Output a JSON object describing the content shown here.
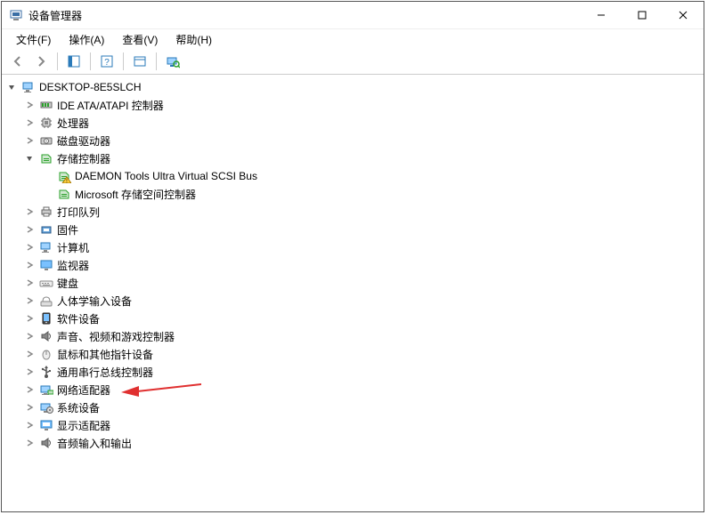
{
  "window": {
    "title": "设备管理器"
  },
  "menus": {
    "file": "文件(F)",
    "action": "操作(A)",
    "view": "查看(V)",
    "help": "帮助(H)"
  },
  "tree": {
    "root": {
      "label": "DESKTOP-8E5SLCH",
      "expanded": true,
      "children": [
        {
          "id": "ide",
          "label": "IDE ATA/ATAPI 控制器",
          "icon": "ide",
          "expanded": false
        },
        {
          "id": "cpu",
          "label": "处理器",
          "icon": "cpu",
          "expanded": false
        },
        {
          "id": "disk",
          "label": "磁盘驱动器",
          "icon": "disk",
          "expanded": false
        },
        {
          "id": "storage",
          "label": "存储控制器",
          "icon": "storage",
          "expanded": true,
          "children": [
            {
              "id": "daemon",
              "label": "DAEMON Tools Ultra Virtual SCSI Bus",
              "icon": "storage-warn"
            },
            {
              "id": "msss",
              "label": "Microsoft 存储空间控制器",
              "icon": "storage"
            }
          ]
        },
        {
          "id": "printq",
          "label": "打印队列",
          "icon": "print",
          "expanded": false
        },
        {
          "id": "firmware",
          "label": "固件",
          "icon": "firmware",
          "expanded": false
        },
        {
          "id": "computer",
          "label": "计算机",
          "icon": "computer",
          "expanded": false
        },
        {
          "id": "monitor",
          "label": "监视器",
          "icon": "monitor",
          "expanded": false
        },
        {
          "id": "keyboard",
          "label": "键盘",
          "icon": "keyboard",
          "expanded": false
        },
        {
          "id": "hid",
          "label": "人体学输入设备",
          "icon": "hid",
          "expanded": false
        },
        {
          "id": "softdev",
          "label": "软件设备",
          "icon": "softdev",
          "expanded": false
        },
        {
          "id": "sound",
          "label": "声音、视频和游戏控制器",
          "icon": "sound",
          "expanded": false
        },
        {
          "id": "mouse",
          "label": "鼠标和其他指针设备",
          "icon": "mouse",
          "expanded": false
        },
        {
          "id": "usb",
          "label": "通用串行总线控制器",
          "icon": "usb",
          "expanded": false
        },
        {
          "id": "network",
          "label": "网络适配器",
          "icon": "network",
          "expanded": false,
          "arrow": true
        },
        {
          "id": "system",
          "label": "系统设备",
          "icon": "system",
          "expanded": false
        },
        {
          "id": "display",
          "label": "显示适配器",
          "icon": "display",
          "expanded": false
        },
        {
          "id": "audioio",
          "label": "音频输入和输出",
          "icon": "sound",
          "expanded": false
        }
      ]
    }
  },
  "colors": {
    "arrow": "#E03030"
  }
}
